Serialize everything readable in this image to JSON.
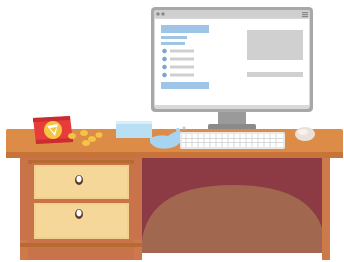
{
  "scene": {
    "background": "#ffffff",
    "colors": {
      "desk_top": "#dd8c48",
      "desk_edge": "#b86a33",
      "desk_wood": "#c8734a",
      "drawer_face": "#f2d08d",
      "drawer_panel": "#f7dca4",
      "back_panel": "#8c3b45",
      "back_arc": "#a0654f",
      "monitor_frame": "#a8a8a8",
      "monitor_screen": "#ffffff",
      "screen_accent": "#9ec5e6",
      "screen_placeholder": "#d6d6d6",
      "chip_bag": "#e83b3b",
      "chips": "#f4c542",
      "glass": "#b9dff4",
      "keyboard": "#ffffff",
      "mouse": "#e9e1da"
    },
    "objects": [
      {
        "name": "desk",
        "icon": "desk-icon"
      },
      {
        "name": "monitor",
        "icon": "monitor-icon"
      },
      {
        "name": "keyboard",
        "icon": "keyboard-icon"
      },
      {
        "name": "mouse",
        "icon": "mouse-icon"
      },
      {
        "name": "chip-bag",
        "icon": "chip-bag-icon"
      },
      {
        "name": "spilled-glass",
        "icon": "glass-icon"
      },
      {
        "name": "drawer-top",
        "icon": "drawer-icon"
      },
      {
        "name": "drawer-bottom",
        "icon": "drawer-icon"
      }
    ]
  }
}
